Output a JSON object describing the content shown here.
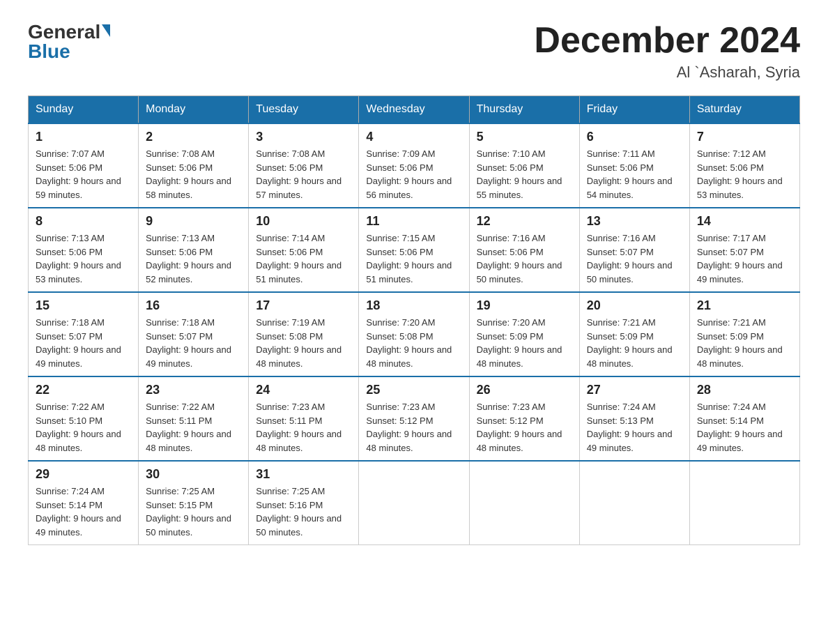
{
  "header": {
    "logo_general": "General",
    "logo_blue": "Blue",
    "month_title": "December 2024",
    "location": "Al `Asharah, Syria"
  },
  "days_of_week": [
    "Sunday",
    "Monday",
    "Tuesday",
    "Wednesday",
    "Thursday",
    "Friday",
    "Saturday"
  ],
  "weeks": [
    [
      {
        "day": "1",
        "sunrise": "7:07 AM",
        "sunset": "5:06 PM",
        "daylight": "9 hours and 59 minutes."
      },
      {
        "day": "2",
        "sunrise": "7:08 AM",
        "sunset": "5:06 PM",
        "daylight": "9 hours and 58 minutes."
      },
      {
        "day": "3",
        "sunrise": "7:08 AM",
        "sunset": "5:06 PM",
        "daylight": "9 hours and 57 minutes."
      },
      {
        "day": "4",
        "sunrise": "7:09 AM",
        "sunset": "5:06 PM",
        "daylight": "9 hours and 56 minutes."
      },
      {
        "day": "5",
        "sunrise": "7:10 AM",
        "sunset": "5:06 PM",
        "daylight": "9 hours and 55 minutes."
      },
      {
        "day": "6",
        "sunrise": "7:11 AM",
        "sunset": "5:06 PM",
        "daylight": "9 hours and 54 minutes."
      },
      {
        "day": "7",
        "sunrise": "7:12 AM",
        "sunset": "5:06 PM",
        "daylight": "9 hours and 53 minutes."
      }
    ],
    [
      {
        "day": "8",
        "sunrise": "7:13 AM",
        "sunset": "5:06 PM",
        "daylight": "9 hours and 53 minutes."
      },
      {
        "day": "9",
        "sunrise": "7:13 AM",
        "sunset": "5:06 PM",
        "daylight": "9 hours and 52 minutes."
      },
      {
        "day": "10",
        "sunrise": "7:14 AM",
        "sunset": "5:06 PM",
        "daylight": "9 hours and 51 minutes."
      },
      {
        "day": "11",
        "sunrise": "7:15 AM",
        "sunset": "5:06 PM",
        "daylight": "9 hours and 51 minutes."
      },
      {
        "day": "12",
        "sunrise": "7:16 AM",
        "sunset": "5:06 PM",
        "daylight": "9 hours and 50 minutes."
      },
      {
        "day": "13",
        "sunrise": "7:16 AM",
        "sunset": "5:07 PM",
        "daylight": "9 hours and 50 minutes."
      },
      {
        "day": "14",
        "sunrise": "7:17 AM",
        "sunset": "5:07 PM",
        "daylight": "9 hours and 49 minutes."
      }
    ],
    [
      {
        "day": "15",
        "sunrise": "7:18 AM",
        "sunset": "5:07 PM",
        "daylight": "9 hours and 49 minutes."
      },
      {
        "day": "16",
        "sunrise": "7:18 AM",
        "sunset": "5:07 PM",
        "daylight": "9 hours and 49 minutes."
      },
      {
        "day": "17",
        "sunrise": "7:19 AM",
        "sunset": "5:08 PM",
        "daylight": "9 hours and 48 minutes."
      },
      {
        "day": "18",
        "sunrise": "7:20 AM",
        "sunset": "5:08 PM",
        "daylight": "9 hours and 48 minutes."
      },
      {
        "day": "19",
        "sunrise": "7:20 AM",
        "sunset": "5:09 PM",
        "daylight": "9 hours and 48 minutes."
      },
      {
        "day": "20",
        "sunrise": "7:21 AM",
        "sunset": "5:09 PM",
        "daylight": "9 hours and 48 minutes."
      },
      {
        "day": "21",
        "sunrise": "7:21 AM",
        "sunset": "5:09 PM",
        "daylight": "9 hours and 48 minutes."
      }
    ],
    [
      {
        "day": "22",
        "sunrise": "7:22 AM",
        "sunset": "5:10 PM",
        "daylight": "9 hours and 48 minutes."
      },
      {
        "day": "23",
        "sunrise": "7:22 AM",
        "sunset": "5:11 PM",
        "daylight": "9 hours and 48 minutes."
      },
      {
        "day": "24",
        "sunrise": "7:23 AM",
        "sunset": "5:11 PM",
        "daylight": "9 hours and 48 minutes."
      },
      {
        "day": "25",
        "sunrise": "7:23 AM",
        "sunset": "5:12 PM",
        "daylight": "9 hours and 48 minutes."
      },
      {
        "day": "26",
        "sunrise": "7:23 AM",
        "sunset": "5:12 PM",
        "daylight": "9 hours and 48 minutes."
      },
      {
        "day": "27",
        "sunrise": "7:24 AM",
        "sunset": "5:13 PM",
        "daylight": "9 hours and 49 minutes."
      },
      {
        "day": "28",
        "sunrise": "7:24 AM",
        "sunset": "5:14 PM",
        "daylight": "9 hours and 49 minutes."
      }
    ],
    [
      {
        "day": "29",
        "sunrise": "7:24 AM",
        "sunset": "5:14 PM",
        "daylight": "9 hours and 49 minutes."
      },
      {
        "day": "30",
        "sunrise": "7:25 AM",
        "sunset": "5:15 PM",
        "daylight": "9 hours and 50 minutes."
      },
      {
        "day": "31",
        "sunrise": "7:25 AM",
        "sunset": "5:16 PM",
        "daylight": "9 hours and 50 minutes."
      },
      null,
      null,
      null,
      null
    ]
  ]
}
